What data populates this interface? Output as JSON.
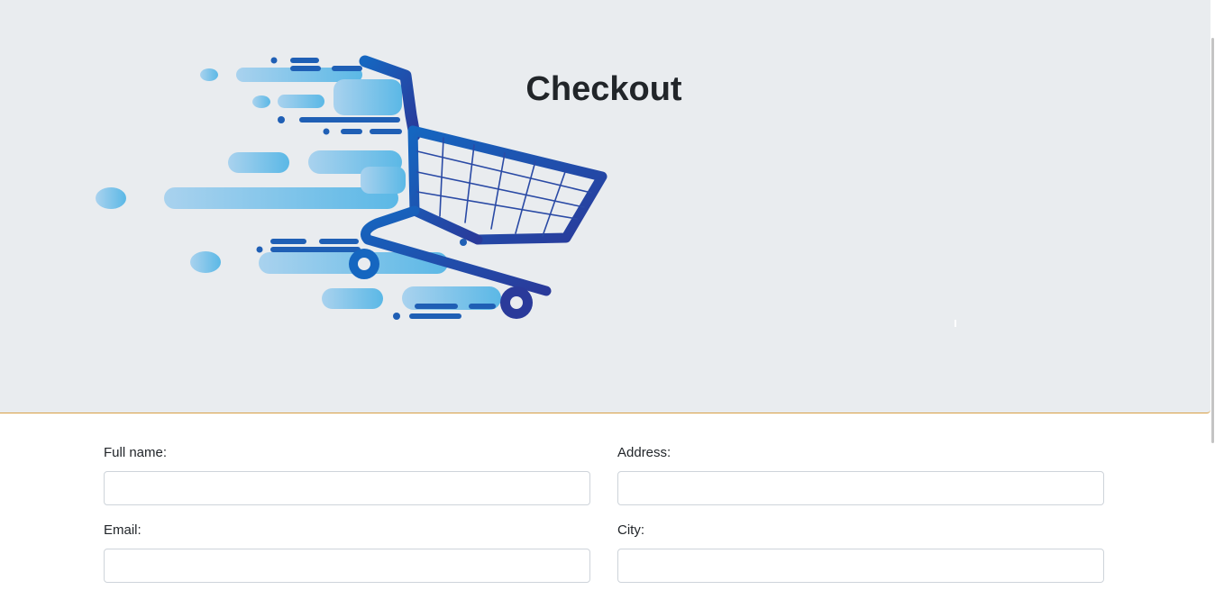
{
  "header": {
    "title": "Checkout",
    "illustration": "shopping-cart-icon"
  },
  "form": {
    "full_name": {
      "label": "Full name:",
      "value": "",
      "placeholder": ""
    },
    "address": {
      "label": "Address:",
      "value": "",
      "placeholder": ""
    },
    "email": {
      "label": "Email:",
      "value": "",
      "placeholder": ""
    },
    "city": {
      "label": "City:",
      "value": "",
      "placeholder": ""
    }
  },
  "colors": {
    "hero_background": "#e9ecef",
    "cart_dark_blue": "#1f3f9e",
    "cart_mid_blue": "#1565c0",
    "speed_light_blue": "#7cc3e8",
    "hero_border": "#d9a046"
  }
}
